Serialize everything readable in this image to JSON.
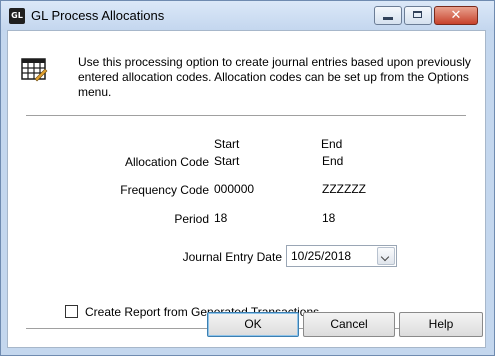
{
  "window": {
    "title": "GL Process Allocations",
    "app_icon_text": "GL",
    "close_glyph": "✕"
  },
  "info": {
    "icon": "journal-table-icon",
    "text": "Use this processing option to create journal entries based upon previously entered allocation codes. Allocation codes can be set up from the Options menu."
  },
  "columns": {
    "start": "Start",
    "end": "End"
  },
  "allocation_code": {
    "label": "Allocation Code",
    "start": "Start",
    "end": "End"
  },
  "frequency_code": {
    "label": "Frequency Code",
    "start": "000000",
    "end": "ZZZZZZ"
  },
  "period": {
    "label": "Period",
    "start": "18",
    "end": "18"
  },
  "journal_entry_date": {
    "label": "Journal Entry Date",
    "value": "10/25/2018"
  },
  "report_option": {
    "label": "Create Report from Generated Transactions",
    "checked": false
  },
  "buttons": {
    "ok": "OK",
    "cancel": "Cancel",
    "help": "Help"
  },
  "colors": {
    "titlebar": "#c4d7ee",
    "close_button": "#c7422c",
    "default_button_border": "#3c7fb1"
  }
}
